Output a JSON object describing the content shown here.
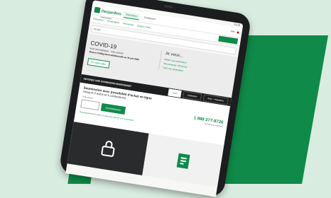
{
  "status": {
    "time": "11:24"
  },
  "header": {
    "logo": "Desjardins",
    "logo_sub": "Assurances",
    "tabs": [
      "Particuliers",
      "Entreprises"
    ],
    "help": "Aide",
    "access_button": "Se connecter"
  },
  "subnav": {
    "items": [
      "Assurance",
      "Réclamation",
      "Prévention",
      "Espace client"
    ]
  },
  "search": {
    "value": "Accueil"
  },
  "hero": {
    "title": "COVID-19",
    "line1": "Vous accompagner : notre priorité",
    "line2": "Mesure d'allègement additionnelle au 30 juin 2020",
    "button": "En savoir plus"
  },
  "je_veux": {
    "title": "Je veux...",
    "links": [
      "Obtenir une soumission",
      "Me connecter / M'inscrire",
      "Faire une réclamation"
    ]
  },
  "quote_band": {
    "title": "OBTENEZ UNE SOUMISSION MAINTENANT",
    "segments": [
      "Auto",
      "Habitation",
      "Auto + Habitation"
    ]
  },
  "quote": {
    "title": "Soumission avec possibilité d'achat en ligne",
    "subtitle": "(Jusqu'à 2 autos et 3 conducteurs)",
    "field_label": "Code postal",
    "button": "Commencer",
    "phone": "1 888 277-8726",
    "phone_caption": "Du lundi au vendredi",
    "link": "Renseignements à avoir en main pour obtenir une soumission"
  },
  "colors": {
    "brand": "#0f8a48",
    "dark": "#1d1e1f"
  }
}
